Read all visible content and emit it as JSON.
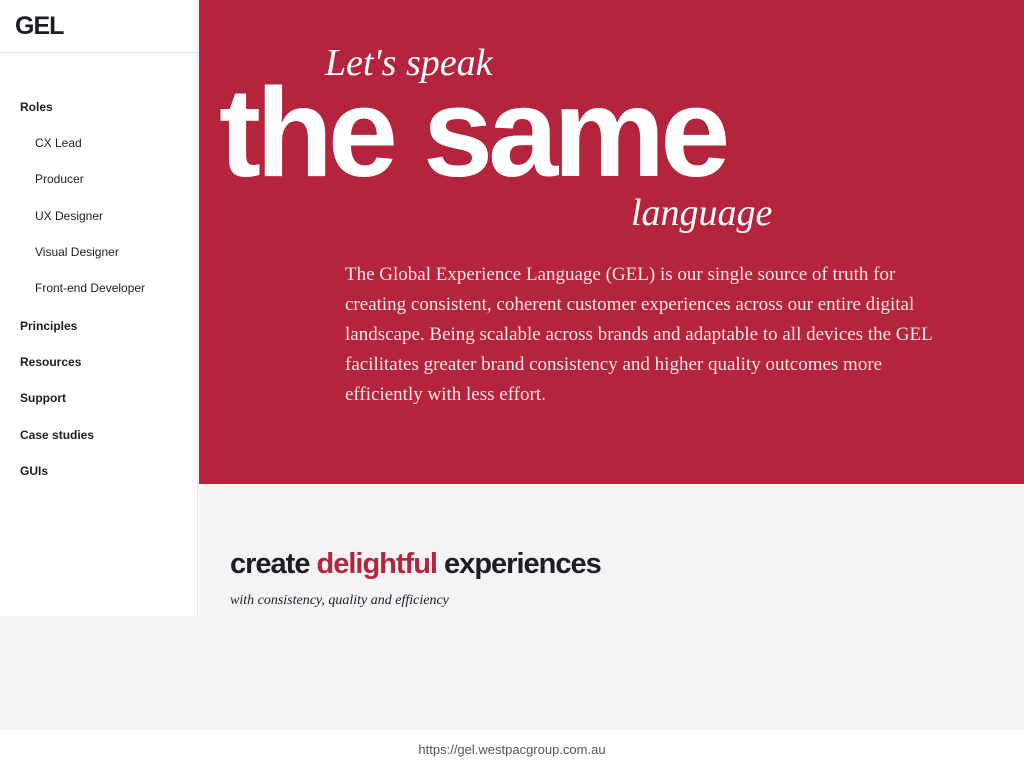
{
  "brand": {
    "logo_text": "GEL"
  },
  "sidebar": {
    "items": [
      {
        "label": "Roles",
        "kind": "section"
      },
      {
        "label": "CX Lead",
        "kind": "sub"
      },
      {
        "label": "Producer",
        "kind": "sub"
      },
      {
        "label": "UX Designer",
        "kind": "sub"
      },
      {
        "label": "Visual Designer",
        "kind": "sub"
      },
      {
        "label": "Front-end Developer",
        "kind": "sub"
      },
      {
        "label": "Principles",
        "kind": "section"
      },
      {
        "label": "Resources",
        "kind": "section"
      },
      {
        "label": "Support",
        "kind": "section"
      },
      {
        "label": "Case studies",
        "kind": "section"
      },
      {
        "label": "GUIs",
        "kind": "section"
      }
    ]
  },
  "hero": {
    "kicker": "Let's speak",
    "headline": "the same",
    "tail": "language",
    "body": "The Global Experience Language (GEL) is our single source of truth for creating consistent, coherent customer experiences across our entire digital landscape. Being scalable across brands and adaptable to all devices the GEL facilitates greater brand consistency and higher quality outcomes more efficiently with less effort."
  },
  "section": {
    "title_part1": "create ",
    "title_accent": "delightful",
    "title_part2": " experiences",
    "subtitle": "with consistency, quality and efficiency"
  },
  "footer": {
    "url": "https://gel.westpacgroup.com.au"
  },
  "colors": {
    "brand_red": "#b5243d",
    "text_dark": "#1f1c24",
    "light_bg": "#f3f4f5"
  }
}
